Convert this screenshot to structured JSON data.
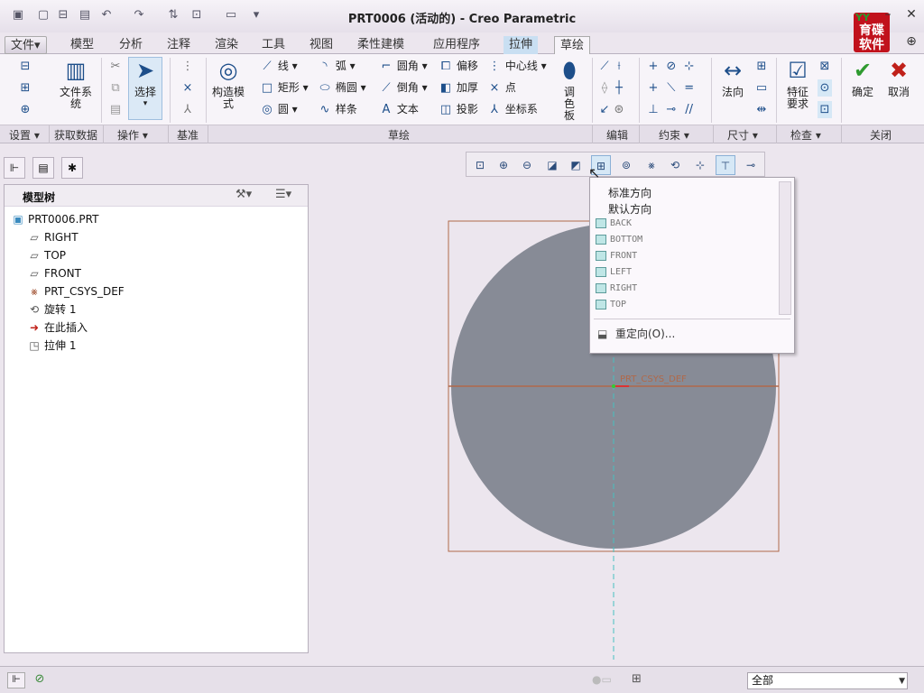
{
  "window": {
    "title": "PRT0006 (活动的) - Creo Parametric",
    "logo_text": "育碟软件"
  },
  "menu_tabs": [
    "文件▾",
    "模型",
    "分析",
    "注释",
    "渲染",
    "工具",
    "视图",
    "柔性建模",
    "应用程序",
    "拉伸",
    "草绘"
  ],
  "ribbon": {
    "setup": {
      "buttons": [
        "文件系统"
      ],
      "group": "设置 ▾"
    },
    "get_data": {
      "group": "获取数据"
    },
    "operations": {
      "select": "选择",
      "group": "操作 ▾"
    },
    "datum": {
      "group": "基准"
    },
    "sketch": {
      "construction_mode": "构造模式",
      "items": [
        "线 ▾",
        "弧 ▾",
        "圆角 ▾",
        "偏移",
        "中心线 ▾",
        "矩形 ▾",
        "椭圆 ▾",
        "倒角 ▾",
        "加厚",
        "点",
        "圆 ▾",
        "样条",
        "文本",
        "投影",
        "坐标系"
      ],
      "palette": "调色板",
      "group": "草绘"
    },
    "edit": {
      "group": "编辑"
    },
    "constrain": {
      "group": "约束 ▾"
    },
    "dimension": {
      "normal": "法向",
      "group": "尺寸 ▾"
    },
    "inspect": {
      "feature_req": "特征要求",
      "group": "检查 ▾"
    },
    "close": {
      "ok": "确定",
      "cancel": "取消",
      "group": "关闭"
    }
  },
  "model_tree": {
    "title": "模型树",
    "items": [
      "PRT0006.PRT",
      "RIGHT",
      "TOP",
      "FRONT",
      "PRT_CSYS_DEF",
      "旋转 1",
      "在此插入",
      "拉伸 1"
    ]
  },
  "views_menu": {
    "standard": "标准方向",
    "default": "默认方向",
    "views": [
      "BACK",
      "BOTTOM",
      "FRONT",
      "LEFT",
      "RIGHT",
      "TOP"
    ],
    "reorient": "重定向(O)..."
  },
  "graphics": {
    "csys_label": "PRT_CSYS_DEF"
  },
  "status": {
    "filter": "全部"
  }
}
